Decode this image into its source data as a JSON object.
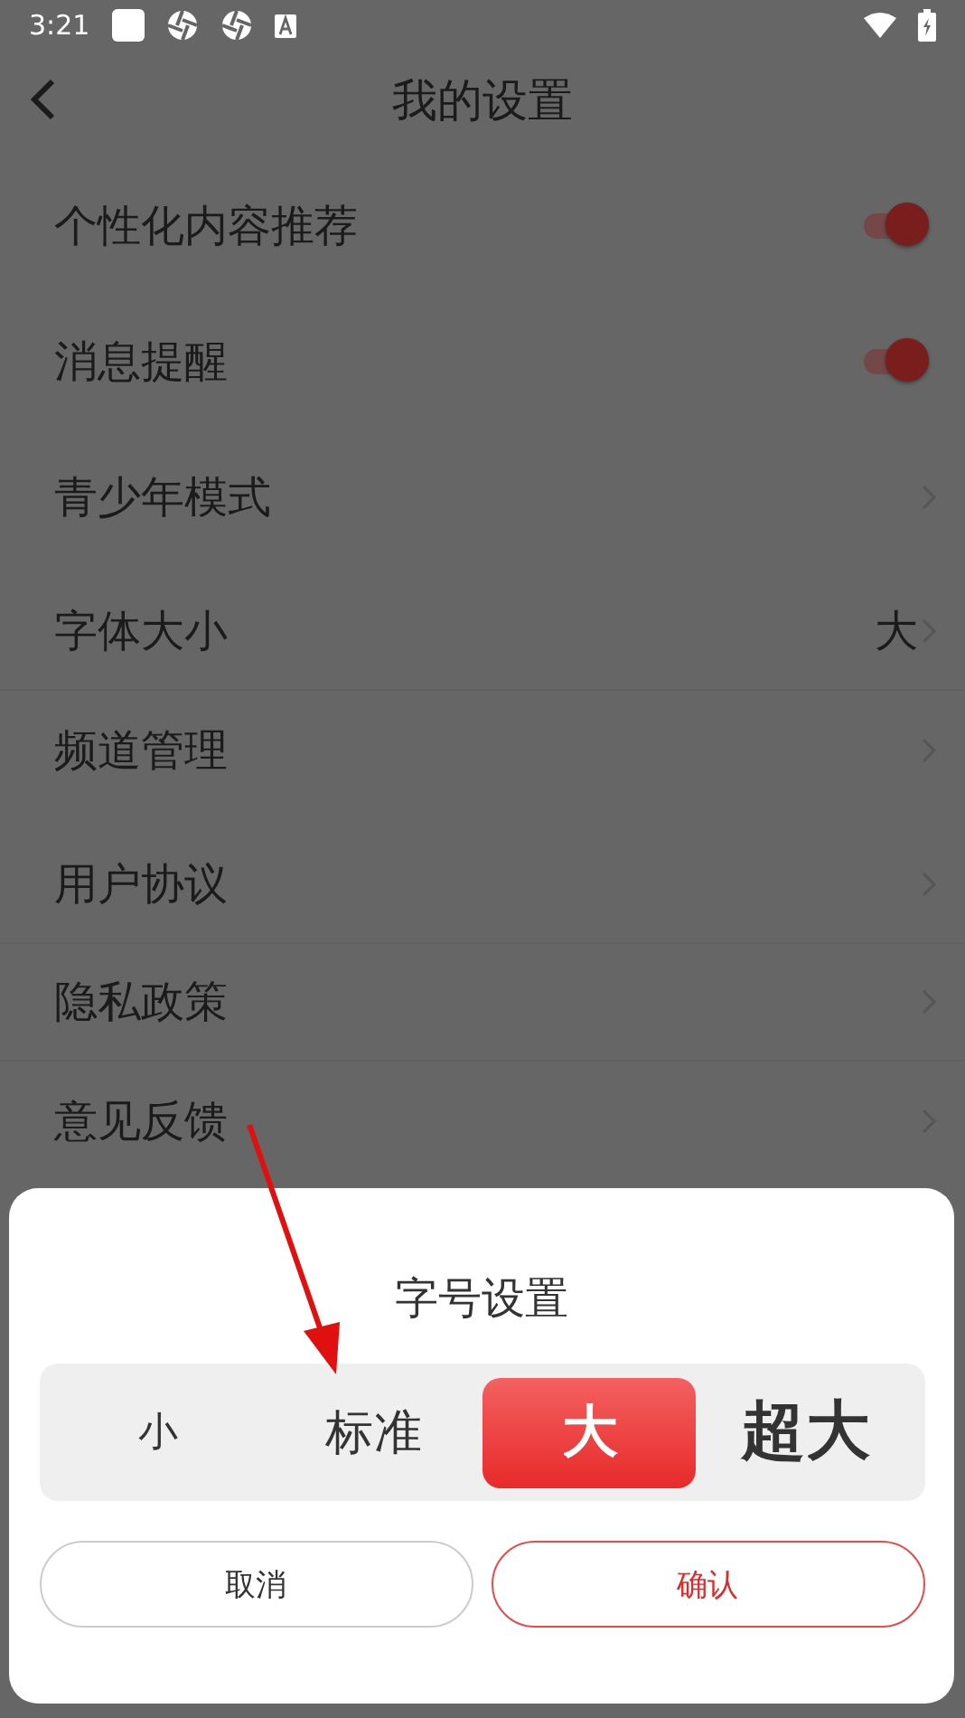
{
  "status_bar": {
    "time": "3:21"
  },
  "header": {
    "title": "我的设置"
  },
  "groups": [
    {
      "items": [
        {
          "label": "个性化内容推荐",
          "kind": "toggle",
          "on": true
        }
      ]
    },
    {
      "items": [
        {
          "label": "消息提醒",
          "kind": "toggle",
          "on": true
        }
      ]
    },
    {
      "items": [
        {
          "label": "青少年模式",
          "kind": "link"
        }
      ]
    },
    {
      "items": [
        {
          "label": "字体大小",
          "kind": "link",
          "value": "大"
        },
        {
          "label": "频道管理",
          "kind": "link"
        }
      ]
    },
    {
      "items": [
        {
          "label": "用户协议",
          "kind": "link"
        },
        {
          "label": "隐私政策",
          "kind": "link"
        },
        {
          "label": "意见反馈",
          "kind": "link"
        }
      ]
    }
  ],
  "dialog": {
    "title": "字号设置",
    "options": [
      {
        "label": "小",
        "selected": false
      },
      {
        "label": "标准",
        "selected": false
      },
      {
        "label": "大",
        "selected": true
      },
      {
        "label": "超大",
        "selected": false
      }
    ],
    "cancel": "取消",
    "confirm": "确认"
  }
}
